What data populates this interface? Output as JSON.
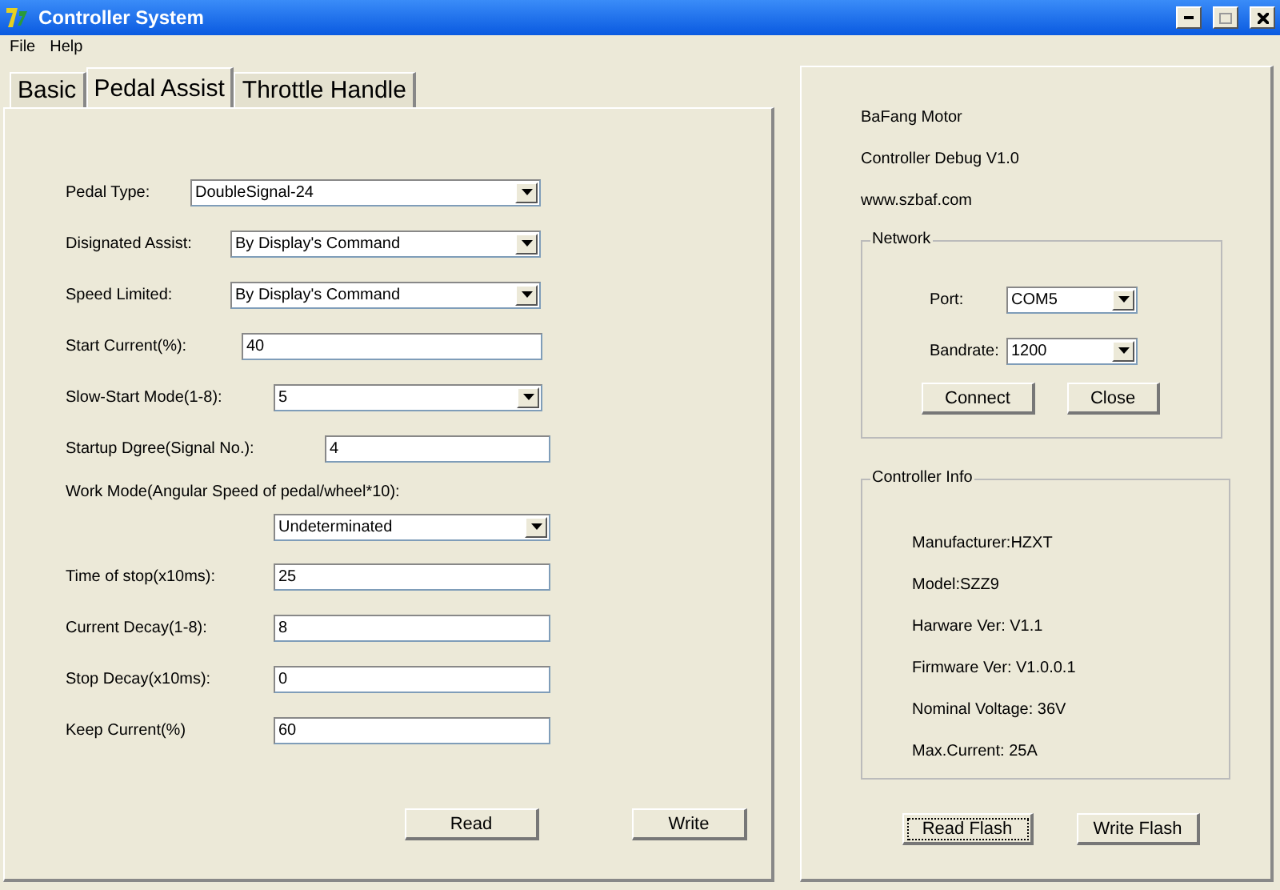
{
  "window": {
    "title": "Controller System"
  },
  "menu": [
    "File",
    "Help"
  ],
  "tabs": [
    {
      "label": "Basic",
      "selected": false
    },
    {
      "label": "Pedal Assist",
      "selected": true
    },
    {
      "label": "Throttle Handle",
      "selected": false
    }
  ],
  "fields": [
    {
      "label": "Pedal Type:",
      "kind": "dropdown",
      "value": "DoubleSignal-24"
    },
    {
      "label": "Disignated Assist:",
      "kind": "dropdown",
      "value": "By Display's Command"
    },
    {
      "label": "Speed Limited:",
      "kind": "dropdown",
      "value": "By Display's Command"
    },
    {
      "label": "Start Current(%):",
      "kind": "input",
      "value": "40"
    },
    {
      "label": "Slow-Start Mode(1-8):",
      "kind": "dropdown",
      "value": "5"
    },
    {
      "label": "Startup Dgree(Signal No.):",
      "kind": "input",
      "value": "4"
    },
    {
      "label": "Work Mode(Angular Speed of pedal/wheel*10):",
      "kind": "dropdown",
      "value": "Undeterminated"
    },
    {
      "label": "Time of stop(x10ms):",
      "kind": "input",
      "value": "25"
    },
    {
      "label": "Current Decay(1-8):",
      "kind": "input",
      "value": "8"
    },
    {
      "label": "Stop Decay(x10ms):",
      "kind": "input",
      "value": "0"
    },
    {
      "label": "Keep Current(%)",
      "kind": "input",
      "value": "60"
    }
  ],
  "tab_buttons": [
    {
      "label": "Read",
      "focused": false
    },
    {
      "label": "Write",
      "focused": false
    }
  ],
  "about": [
    "BaFang Motor",
    "Controller Debug V1.0",
    "www.szbaf.com"
  ],
  "network": {
    "title": "Network",
    "fields": [
      {
        "label": "Port:",
        "value": "COM5"
      },
      {
        "label": "Bandrate:",
        "value": "1200"
      }
    ],
    "buttons": [
      {
        "label": "Connect",
        "focused": false
      },
      {
        "label": "Close",
        "focused": false
      }
    ]
  },
  "controller_info": {
    "title": "Controller Info",
    "lines": [
      "Manufacturer:HZXT",
      "Model:SZZ9",
      "Harware Ver: V1.1",
      "Firmware Ver: V1.0.0.1",
      "Nominal Voltage: 36V",
      "Max.Current: 25A"
    ]
  },
  "flash_buttons": [
    {
      "label": "Read Flash",
      "focused": true
    },
    {
      "label": "Write Flash",
      "focused": false
    }
  ]
}
